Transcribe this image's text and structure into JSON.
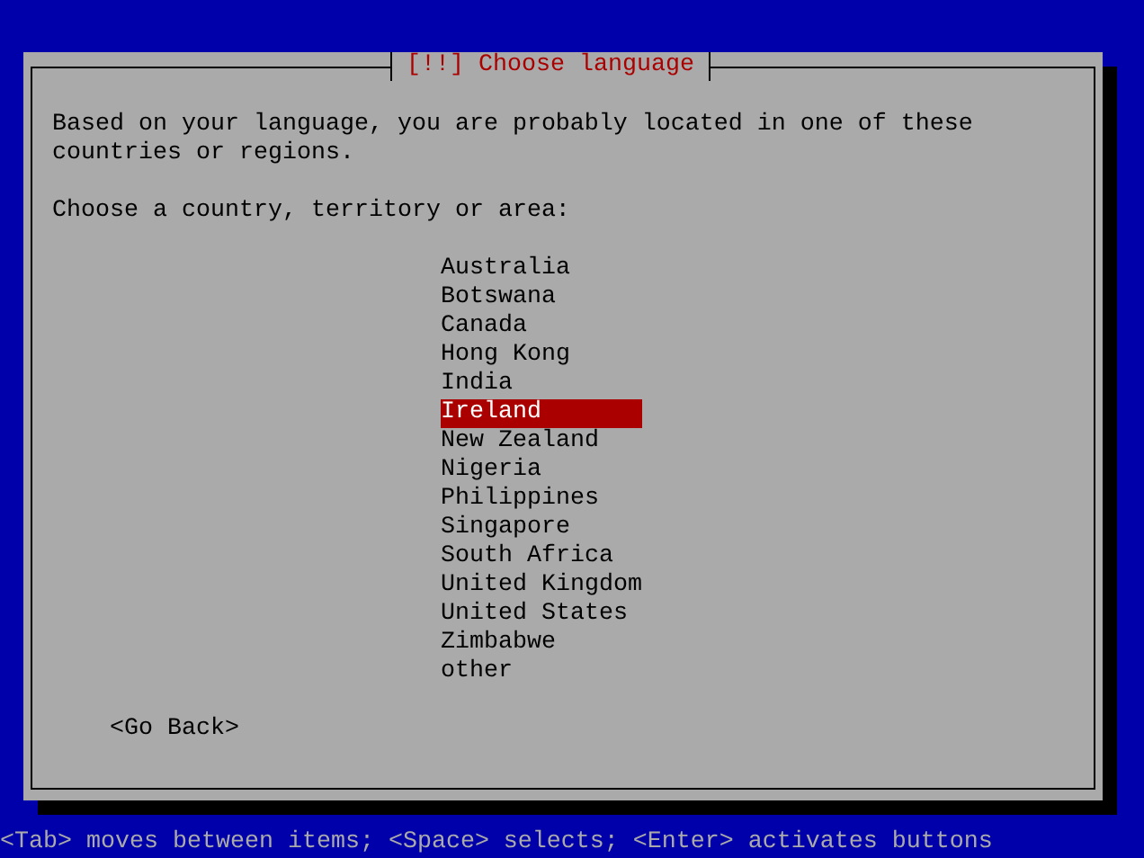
{
  "dialog": {
    "title": "[!!] Choose language",
    "message": "Based on your language, you are probably located in one of these countries or regions.",
    "prompt": "Choose a country, territory or area:",
    "options": [
      {
        "label": "Australia",
        "selected": false
      },
      {
        "label": "Botswana",
        "selected": false
      },
      {
        "label": "Canada",
        "selected": false
      },
      {
        "label": "Hong Kong",
        "selected": false
      },
      {
        "label": "India",
        "selected": false
      },
      {
        "label": "Ireland",
        "selected": true
      },
      {
        "label": "New Zealand",
        "selected": false
      },
      {
        "label": "Nigeria",
        "selected": false
      },
      {
        "label": "Philippines",
        "selected": false
      },
      {
        "label": "Singapore",
        "selected": false
      },
      {
        "label": "South Africa",
        "selected": false
      },
      {
        "label": "United Kingdom",
        "selected": false
      },
      {
        "label": "United States",
        "selected": false
      },
      {
        "label": "Zimbabwe",
        "selected": false
      },
      {
        "label": "other",
        "selected": false
      }
    ],
    "buttons": [
      "<Go Back>"
    ]
  },
  "status_bar": "<Tab> moves between items; <Space> selects; <Enter> activates buttons"
}
